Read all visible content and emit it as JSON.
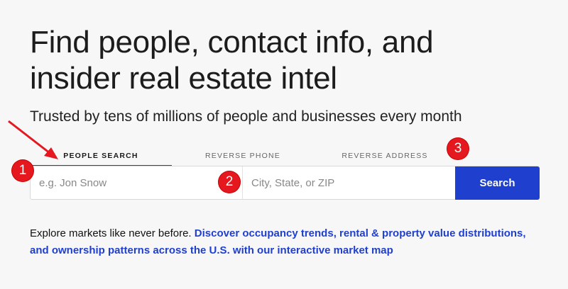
{
  "hero": {
    "headline": "Find people, contact info, and insider real estate intel",
    "subheadline": "Trusted by tens of millions of people and businesses every month"
  },
  "search": {
    "tabs": [
      {
        "label": "PEOPLE SEARCH",
        "active": true
      },
      {
        "label": "REVERSE PHONE",
        "active": false
      },
      {
        "label": "REVERSE ADDRESS",
        "active": false
      }
    ],
    "name_placeholder": "e.g. Jon Snow",
    "location_placeholder": "City, State, or ZIP",
    "button_label": "Search"
  },
  "explore": {
    "intro": "Explore markets like never before.",
    "link_text": "Discover occupancy trends, rental & property value distributions, and ownership patterns across the U.S. with our interactive market map"
  },
  "annotations": {
    "badges": [
      "1",
      "2",
      "3"
    ],
    "color": "#e4181e"
  },
  "colors": {
    "accent": "#1f3fcf",
    "background": "#f7f7f7"
  }
}
